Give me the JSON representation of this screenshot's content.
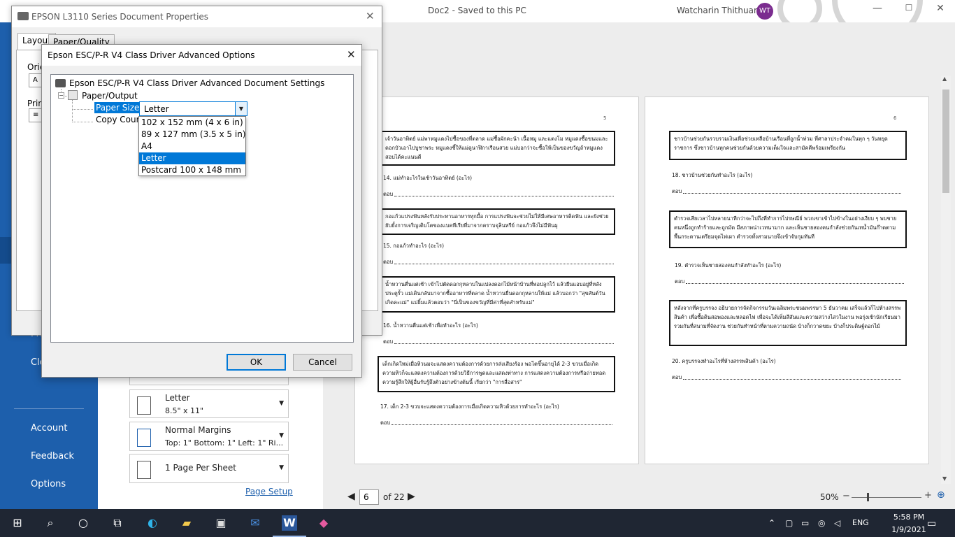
{
  "word": {
    "title": "Doc2  -  Saved to this PC",
    "user_name": "Watcharin Thithuan",
    "user_initials": "WT"
  },
  "backstage_nav": {
    "items": [
      {
        "label": "Pri"
      },
      {
        "label": "Clo"
      },
      {
        "label": "Account"
      },
      {
        "label": "Feedback"
      },
      {
        "label": "Options"
      }
    ]
  },
  "print_settings": {
    "paper": {
      "main": "Letter",
      "sub": "8.5\" x 11\""
    },
    "margins": {
      "main": "Normal Margins",
      "sub": "Top: 1\" Bottom: 1\" Left: 1\" Ri..."
    },
    "pages_per_sheet": {
      "main": "1 Page Per Sheet"
    },
    "page_setup_link": "Page Setup"
  },
  "preview": {
    "current_page": "6",
    "page_of": "of 22",
    "zoom": "50%",
    "pages": [
      {
        "number": "5",
        "boxes": [
          "เจ้าวันอาทิตย์ แม่พาหมูแดงไปซื้อของที่ตลาด แม่ซื้อผักคะน้า เนื้อหมู และแตงโม หมูแดงซื้อขนมและดอกบัวเอาไปบูชาพระ หมูแดงชี้ให้แม่ดูนาฬิกาเรือนสวย แม่บอกว่าจะซื้อให้เป็นของขวัญถ้าหมูแดงสอบได้คะแนนดี",
          "กอแก้วแปรงฟันหลังรับประทานอาหารทุกมื้อ การแปรงฟันจะช่วยไม่ให้มีเศษอาหารติดฟัน และยังช่วยยับยั้งการเจริญเติบโตของแบคทีเรียที่มาจากคราบจุลินทรีย์ กอแก้วจึงไม่มีฟันผุ",
          "น้ำหวานตื่นแต่เช้า เข้าไปตัดดอกกุหลาบในแปลงดอกไม้หน้าบ้านที่พ่อปลูกไว้ แล้วยืนแอบอยู่ที่หลังประตูรั้ว แม่เดินกลับมาจากซื้ออาหารที่ตลาด น้ำหวานยื่นดอกกุหลาบให้แม่ แล้วบอกว่า \"สุขสันต์วันเกิดคะแม่\" แม่ยิ้มแล้วตอบว่า \"นี่เป็นของขวัญที่มีค่าที่สุดสำหรับแม่\"",
          "เด็กเกิดใหม่เมื่อหิวนมจะแสดงความต้องการด้วยการส่งเสียงร้อง พอโตขึ้นอายุได้ 2-3 ขวบเมื่อเกิดความหิวก็จะแสดงความต้องการด้วยวิธีการพูดและแสดงท่าทาง การแสดงความต้องการหรือถ่ายทอดความรู้สึกให้ผู้อื่นรับรู้ถึงตัวอย่างข้างต้นนี้ เรียกว่า \"การสื่อสาร\""
        ],
        "questions": [
          "14. แม่ทำอะไรในเช้าวันอาทิตย์ (อะไร)",
          "15. กอแก้วทำอะไร (อะไร)",
          "16. น้ำหวานตื่นแต่เช้าเพื่อทำอะไร (อะไร)",
          "17. เด็ก 2-3 ขวบจะแสดงความต้องการเมื่อเกิดความหิวด้วยการทำอะไร (อะไร)"
        ],
        "answer_label": "ตอบ"
      },
      {
        "number": "6",
        "boxes": [
          "ชาวบ้านช่วยกันรวบรวมเงินเพื่อช่วยเหลือบ้านเรือนที่ถูกน้ำท่วม ที่ศาลาประจำคมในทุก ๆ วันหยุดราชการ ซึ่งชาวบ้านทุกคนช่วยกันด้วยความเต็มใจและสามัคคีพร้อมเพรียงกัน",
          "ตำรวจเสียเวลาไปหลายนาทีกว่าจะไปถึงที่ทำการไปรษณีย์ พวกเขาเข้าไปข้างในอย่างเงียบ ๆ พบชายคนหนึ่งถูกทำร้ายและถูกมัด มีสภาพน่าเวทนามาก และเห็นชายสองคนกำลังช่วยกันเทน้ำมันก๊าดตามพื้นกระดานเตรียมจุดไฟเผา ตำรวจทั้งสามนายจึงเข้าจับกุมทันที",
          "หลังจากที่ครูบรรจง อธิบายการจัดกิจกรรมวันเฉลิมพระชนมพรรษา 5 ธันวาคม เสร็จแล้วก็ไปห้างสรรพสินค้า เพื่อซื้อดินสอพองและหลอดไฟ เพื่อจะได้เพิ่มสีสันและความสว่างไสวในงาน พอรุ่งเช้านักเรียนมารวมกันที่สนามที่จัดงาน ช่วยกันทำหน้าที่ตามความถนัด บ้างก็กวาดขยะ บ้างก็ประดิษฐ์ดอกไม้"
        ],
        "questions": [
          "18. ชาวบ้านช่วยกันทำอะไร (อะไร)",
          "19. ตำรวจเห็นชายสองคนกำลังทำอะไร (อะไร)",
          "20. ครูบรรจงทำอะไรที่ห้างสรรพสินค้า (อะไร)"
        ],
        "answer_label": "ตอบ"
      }
    ]
  },
  "doc_properties": {
    "title": "EPSON L3110 Series Document Properties",
    "tabs": [
      "Layout",
      "Paper/Quality"
    ],
    "label_orientation": "Orie",
    "label_print": "Prin",
    "mini_select_a": "A",
    "mini_select_b": "≡"
  },
  "advanced_options": {
    "title": "Epson ESC/P-R V4 Class Driver Advanced Options",
    "tree_root": "Epson ESC/P-R V4 Class Driver Advanced Document Settings",
    "tree_node": "Paper/Output",
    "paper_size_label": "Paper Size:",
    "paper_size_value": "Letter",
    "copy_count_label": "Copy Count",
    "paper_options": [
      "102 x 152 mm (4 x 6 in)",
      "89 x 127 mm (3.5 x 5 in)",
      "A4",
      "Letter",
      "Postcard 100 x 148 mm"
    ],
    "selected_option": "Letter",
    "ok_label": "OK",
    "cancel_label": "Cancel"
  },
  "taskbar": {
    "language": "ENG",
    "time": "5:58 PM",
    "date": "1/9/2021"
  },
  "colors": {
    "backstage_blue": "#1d5fac",
    "selection_blue": "#0078d7",
    "taskbar": "#1f2633",
    "avatar": "#7b2c8f"
  }
}
